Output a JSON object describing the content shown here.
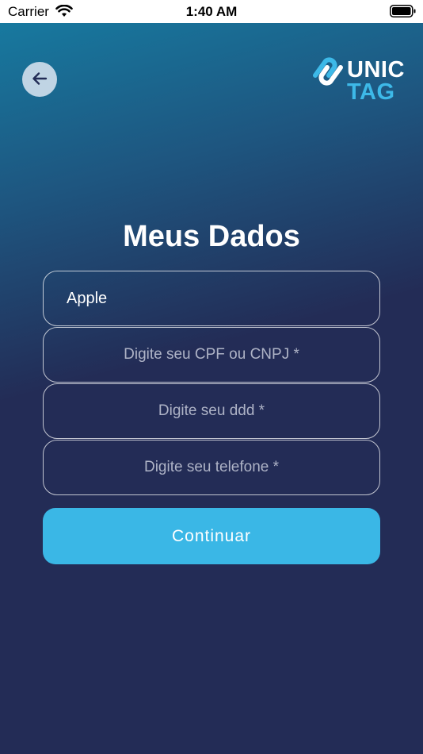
{
  "status_bar": {
    "carrier": "Carrier",
    "time": "1:40 AM",
    "wifi_icon": "wifi-icon",
    "battery_icon": "battery-full-icon"
  },
  "header": {
    "back_icon": "arrow-left-icon",
    "logo": {
      "line1": "UNIC",
      "line2": "TAG"
    }
  },
  "page_title": "Meus Dados",
  "form": {
    "name": {
      "value": "Apple",
      "placeholder": ""
    },
    "document": {
      "value": "",
      "placeholder": "Digite seu CPF ou CNPJ *"
    },
    "ddd": {
      "value": "",
      "placeholder": "Digite seu ddd *"
    },
    "phone": {
      "value": "",
      "placeholder": "Digite seu telefone *"
    }
  },
  "continue_label": "Continuar",
  "colors": {
    "background": "#232c56",
    "gradient_top": "#17799f",
    "accent": "#3ab7e6",
    "back_button": "#c0d4e4"
  }
}
